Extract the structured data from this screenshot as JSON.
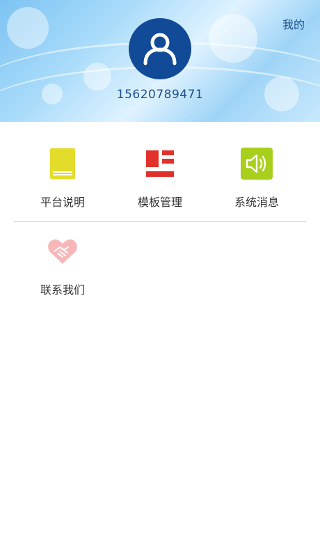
{
  "header": {
    "title": "我的",
    "phone": "15620789471"
  },
  "icons": {
    "avatar": "user-icon",
    "platform": "book-icon",
    "template": "layout-icon",
    "system": "speaker-icon",
    "contact": "handshake-icon"
  },
  "colors": {
    "brand": "#114a97",
    "book": "#e3dc2b",
    "template": "#e0322b",
    "system": "#a8cf1c",
    "contact": "#f7b7b9"
  },
  "menu": {
    "row1": [
      {
        "label": "平台说明"
      },
      {
        "label": "模板管理"
      },
      {
        "label": "系统消息"
      }
    ],
    "row2": [
      {
        "label": "联系我们"
      }
    ]
  }
}
